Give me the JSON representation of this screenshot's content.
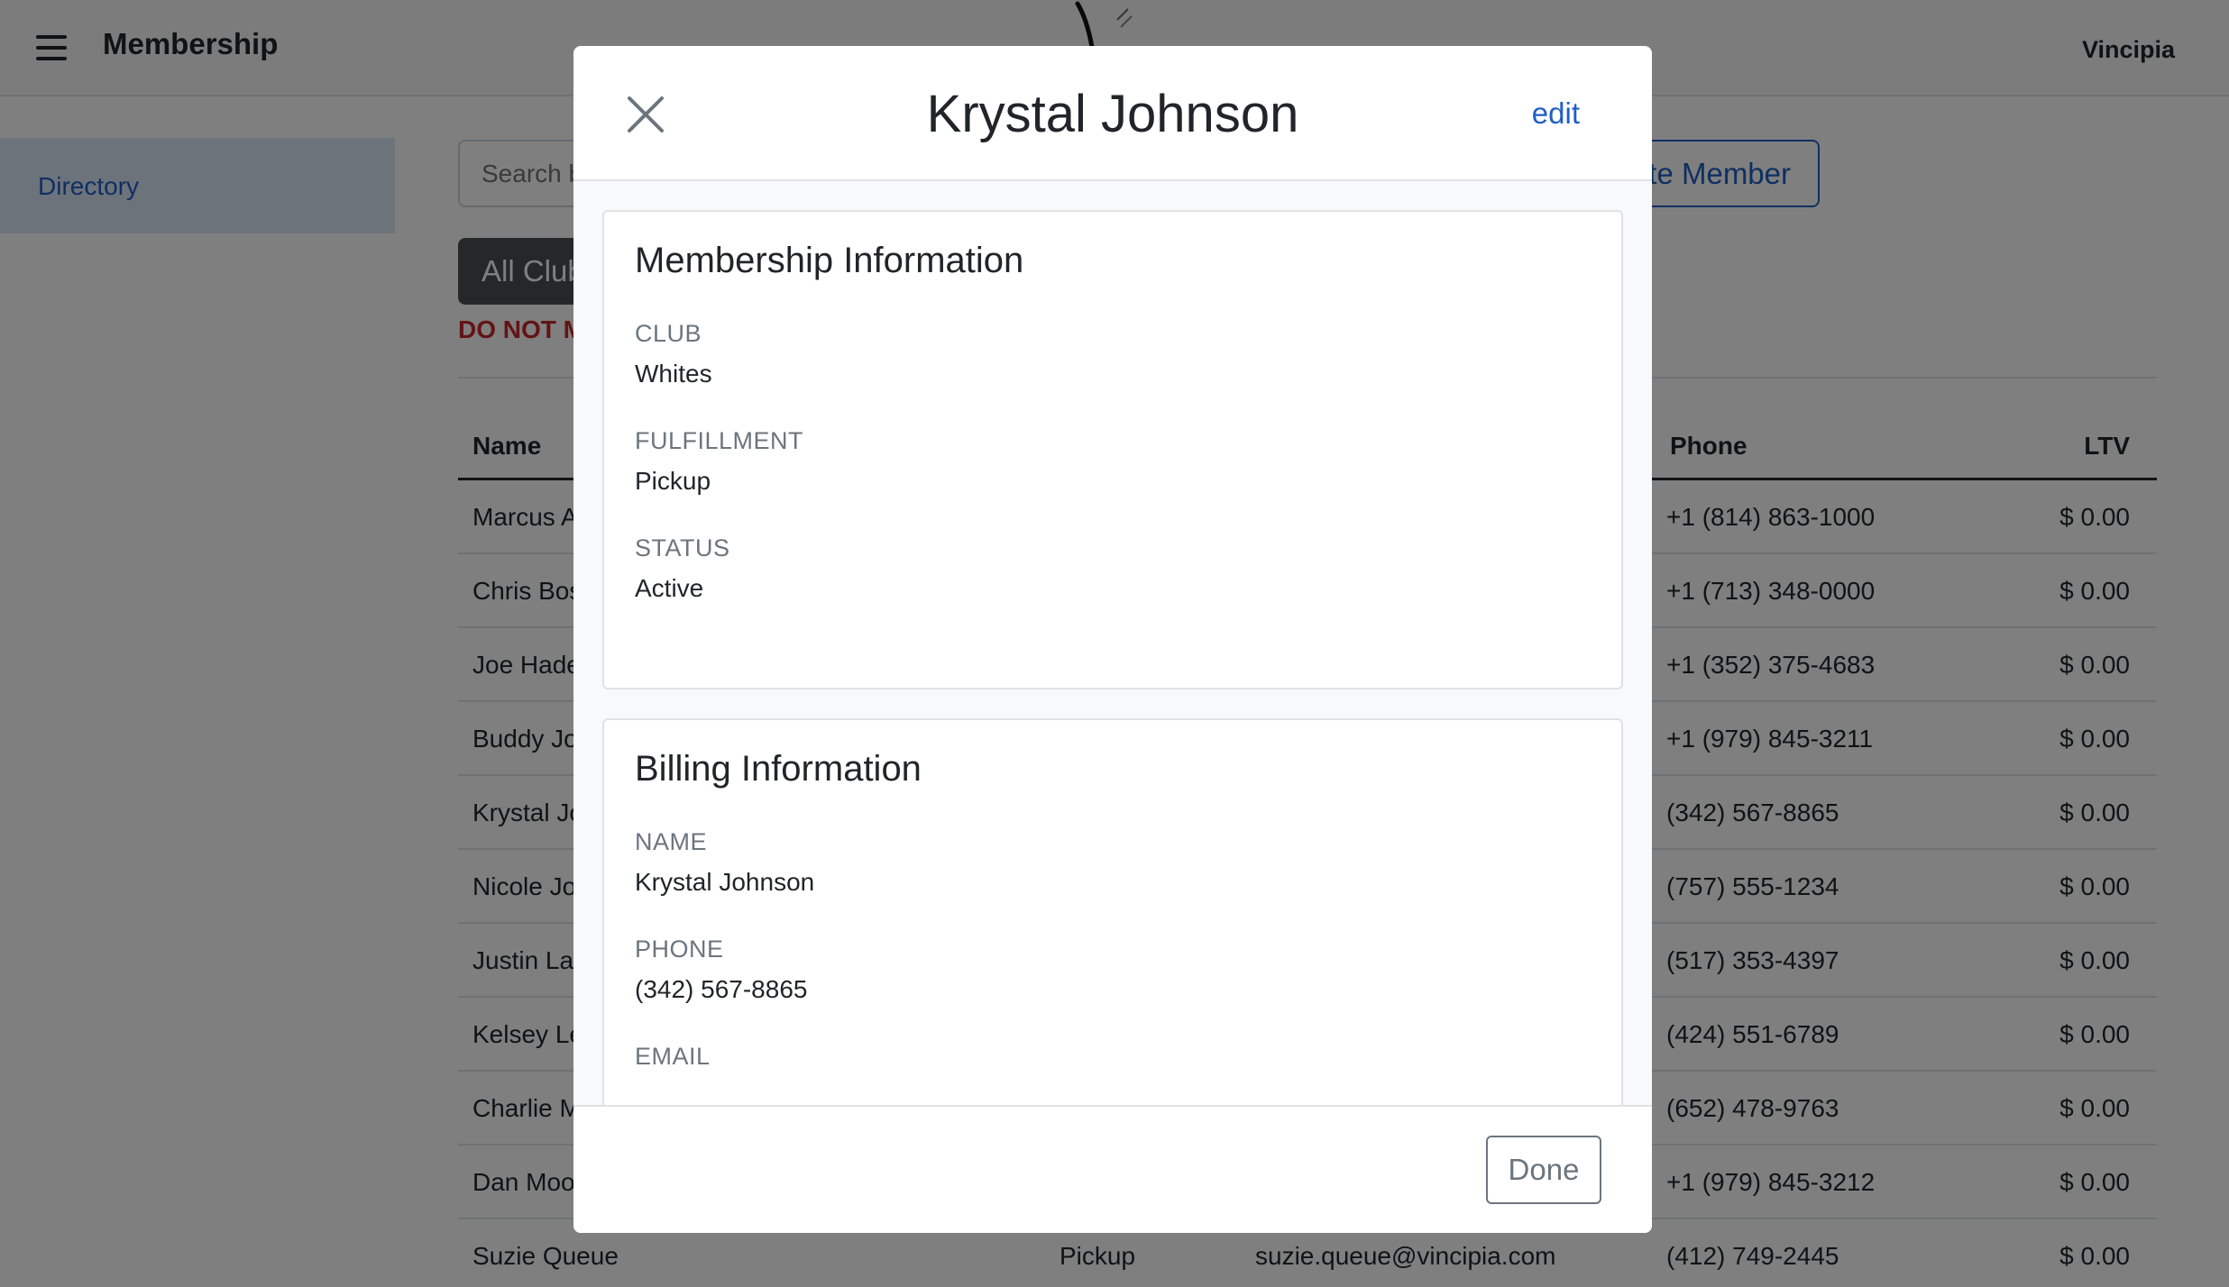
{
  "header": {
    "title": "Membership",
    "org_name": "Vincipia"
  },
  "sidebar": {
    "items": [
      {
        "label": "Directory"
      }
    ]
  },
  "toolbar": {
    "search_placeholder": "Search b",
    "create_label": "te Member",
    "clubs_filter": "All Club",
    "warning_text": "DO NOT M"
  },
  "table": {
    "columns": {
      "name": "Name",
      "phone": "Phone",
      "ltv": "LTV"
    },
    "rows": [
      {
        "name": "Marcus A",
        "fulfillment": "",
        "email": "",
        "phone": "+1 (814) 863-1000",
        "ltv": "$ 0.00"
      },
      {
        "name": "Chris Bos",
        "fulfillment": "",
        "email": "",
        "phone": "+1 (713) 348-0000",
        "ltv": "$ 0.00"
      },
      {
        "name": "Joe Hade",
        "fulfillment": "",
        "email": "",
        "phone": "+1 (352) 375-4683",
        "ltv": "$ 0.00"
      },
      {
        "name": "Buddy Jo",
        "fulfillment": "",
        "email": "",
        "phone": "+1 (979) 845-3211",
        "ltv": "$ 0.00"
      },
      {
        "name": "Krystal Jo",
        "fulfillment": "",
        "email": "",
        "phone": "(342) 567-8865",
        "ltv": "$ 0.00"
      },
      {
        "name": "Nicole Jo",
        "fulfillment": "",
        "email": "",
        "phone": "(757) 555-1234",
        "ltv": "$ 0.00"
      },
      {
        "name": "Justin La",
        "fulfillment": "",
        "email": "",
        "phone": "(517) 353-4397",
        "ltv": "$ 0.00"
      },
      {
        "name": "Kelsey Le",
        "fulfillment": "",
        "email": "",
        "phone": "(424) 551-6789",
        "ltv": "$ 0.00"
      },
      {
        "name": "Charlie M",
        "fulfillment": "",
        "email": "",
        "phone": "(652) 478-9763",
        "ltv": "$ 0.00"
      },
      {
        "name": "Dan Moo",
        "fulfillment": "",
        "email": "",
        "phone": "+1 (979) 845-3212",
        "ltv": "$ 0.00"
      },
      {
        "name": "Suzie Queue",
        "fulfillment": "Pickup",
        "email": "suzie.queue@vincipia.com",
        "phone": "(412) 749-2445",
        "ltv": "$ 0.00"
      }
    ]
  },
  "modal": {
    "title": "Krystal Johnson",
    "edit_label": "edit",
    "done_label": "Done",
    "membership": {
      "title": "Membership Information",
      "club_label": "CLUB",
      "club_value": "Whites",
      "fulfillment_label": "FULFILLMENT",
      "fulfillment_value": "Pickup",
      "status_label": "STATUS",
      "status_value": "Active"
    },
    "billing": {
      "title": "Billing Information",
      "name_label": "NAME",
      "name_value": "Krystal Johnson",
      "phone_label": "PHONE",
      "phone_value": "(342) 567-8865",
      "email_label": "EMAIL"
    }
  },
  "icons": {
    "menu": "hamburger-icon",
    "close": "close-icon",
    "logo": "logo-mark"
  },
  "colors": {
    "accent": "#1f5fc5",
    "warning": "#c62828",
    "sidebar_active": "#dbe6f7"
  }
}
